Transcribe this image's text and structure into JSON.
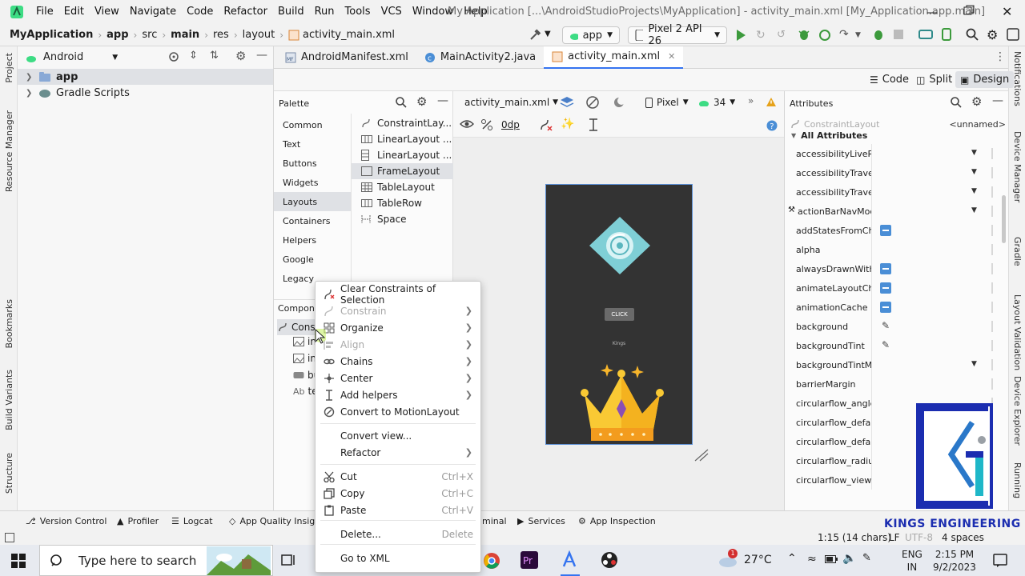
{
  "menu": [
    "File",
    "Edit",
    "View",
    "Navigate",
    "Code",
    "Refactor",
    "Build",
    "Run",
    "Tools",
    "VCS",
    "Window",
    "Help"
  ],
  "window_title": "My Application [...\\AndroidStudioProjects\\MyApplication] - activity_main.xml [My_Application.app.main]",
  "breadcrumb": [
    "MyApplication",
    "app",
    "src",
    "main",
    "res",
    "layout",
    "activity_main.xml"
  ],
  "run_config": "app",
  "device": "Pixel 2 API 26",
  "left_strip": [
    "Project",
    "Resource Manager",
    "Bookmarks",
    "Build Variants",
    "Structure"
  ],
  "right_strip": [
    "Notifications",
    "Device Manager",
    "Gradle",
    "Layout Validation",
    "Device Explorer",
    "Running"
  ],
  "project": {
    "view_mode": "Android",
    "items": [
      {
        "label": "app",
        "bold": true
      },
      {
        "label": "Gradle Scripts",
        "bold": false
      }
    ]
  },
  "tabs": [
    {
      "label": "AndroidManifest.xml",
      "active": false
    },
    {
      "label": "MainActivity2.java",
      "active": false
    },
    {
      "label": "activity_main.xml",
      "active": true
    }
  ],
  "modes": [
    "Code",
    "Split",
    "Design"
  ],
  "palette": {
    "title": "Palette",
    "categories": [
      "Common",
      "Text",
      "Buttons",
      "Widgets",
      "Layouts",
      "Containers",
      "Helpers",
      "Google",
      "Legacy"
    ],
    "selected_category": "Layouts",
    "items": [
      "ConstraintLay...",
      "LinearLayout ...",
      "LinearLayout ...",
      "FrameLayout",
      "TableLayout",
      "TableRow",
      "Space"
    ],
    "selected_item": "FrameLayout"
  },
  "component_tree": {
    "title": "Compone",
    "items": [
      "Cons",
      "in",
      "in",
      "bu",
      "te"
    ]
  },
  "design_toolbar": {
    "file": "activity_main.xml",
    "device": "Pixel",
    "api": "34",
    "margin": "0dp"
  },
  "preview": {
    "button_label": "CLICK",
    "text": "Kings"
  },
  "attributes": {
    "title": "Attributes",
    "component": "ConstraintLayout",
    "id_value": "<unnamed>",
    "section": "All Attributes",
    "rows": [
      {
        "name": "accessibilityLiveR...",
        "ctl": "dropdown"
      },
      {
        "name": "accessibilityTraver...",
        "ctl": "dropdown"
      },
      {
        "name": "accessibilityTraver...",
        "ctl": "dropdown"
      },
      {
        "name": "actionBarNavMod...",
        "ctl": "dropdown"
      },
      {
        "name": "addStatesFromChi...",
        "ctl": "toggle"
      },
      {
        "name": "alpha",
        "ctl": "none"
      },
      {
        "name": "alwaysDrawnWith...",
        "ctl": "toggle"
      },
      {
        "name": "animateLayoutCha...",
        "ctl": "toggle"
      },
      {
        "name": "animationCache",
        "ctl": "toggle"
      },
      {
        "name": "background",
        "ctl": "picker"
      },
      {
        "name": "backgroundTint",
        "ctl": "picker"
      },
      {
        "name": "backgroundTintM...",
        "ctl": "dropdown"
      },
      {
        "name": "barrierMargin",
        "ctl": "none"
      },
      {
        "name": "circularflow_angles",
        "ctl": "none"
      },
      {
        "name": "circularflow_defau...",
        "ctl": "none"
      },
      {
        "name": "circularflow_defau...",
        "ctl": "none"
      },
      {
        "name": "circularflow_radiu...",
        "ctl": "none"
      },
      {
        "name": "circularflow_view...",
        "ctl": "none"
      }
    ]
  },
  "context_menu": {
    "items": [
      {
        "label": "Clear Constraints of Selection",
        "icon": "clear-constraints-icon",
        "disabled": false,
        "submenu": false,
        "shortcut": ""
      },
      {
        "label": "Constrain",
        "icon": "constrain-icon",
        "disabled": true,
        "submenu": true,
        "shortcut": ""
      },
      {
        "label": "Organize",
        "icon": "organize-icon",
        "disabled": false,
        "submenu": true,
        "shortcut": ""
      },
      {
        "label": "Align",
        "icon": "align-icon",
        "disabled": true,
        "submenu": true,
        "shortcut": ""
      },
      {
        "label": "Chains",
        "icon": "chains-icon",
        "disabled": false,
        "submenu": true,
        "shortcut": ""
      },
      {
        "label": "Center",
        "icon": "center-icon",
        "disabled": false,
        "submenu": true,
        "shortcut": ""
      },
      {
        "label": "Add helpers",
        "icon": "add-helpers-icon",
        "disabled": false,
        "submenu": true,
        "shortcut": ""
      },
      {
        "label": "Convert to MotionLayout",
        "icon": "motion-layout-icon",
        "disabled": false,
        "submenu": false,
        "shortcut": ""
      },
      {
        "label": "Convert view...",
        "icon": "",
        "disabled": false,
        "submenu": false,
        "shortcut": ""
      },
      {
        "label": "Refactor",
        "icon": "",
        "disabled": false,
        "submenu": true,
        "shortcut": ""
      },
      {
        "label": "Cut",
        "icon": "cut-icon",
        "disabled": false,
        "submenu": false,
        "shortcut": "Ctrl+X"
      },
      {
        "label": "Copy",
        "icon": "copy-icon",
        "disabled": false,
        "submenu": false,
        "shortcut": "Ctrl+C"
      },
      {
        "label": "Paste",
        "icon": "paste-icon",
        "disabled": false,
        "submenu": false,
        "shortcut": "Ctrl+V"
      },
      {
        "label": "Delete...",
        "icon": "",
        "disabled": false,
        "submenu": false,
        "shortcut": "Delete"
      },
      {
        "label": "Go to XML",
        "icon": "",
        "disabled": false,
        "submenu": false,
        "shortcut": ""
      }
    ]
  },
  "bottom_tools": [
    "Version Control",
    "Profiler",
    "Logcat",
    "App Quality Insight",
    "minal",
    "Services",
    "App Inspection"
  ],
  "status": {
    "position": "1:15 (14 chars)",
    "line_sep": "LF",
    "encoding": "UTF-8",
    "indent": "4 spaces"
  },
  "taskbar": {
    "search_placeholder": "Type here to search",
    "weather": "27°C",
    "notification_count": "1",
    "language": "ENG",
    "region": "IN",
    "time": "2:15 PM",
    "date": "9/2/2023"
  },
  "watermark": "KINGS ENGINEERING",
  "colors": {
    "accent": "#3574f0",
    "run": "#3c9a3c",
    "device_bg": "#333333",
    "toggle": "#4a8ed6",
    "watermark": "#1b2db0"
  }
}
